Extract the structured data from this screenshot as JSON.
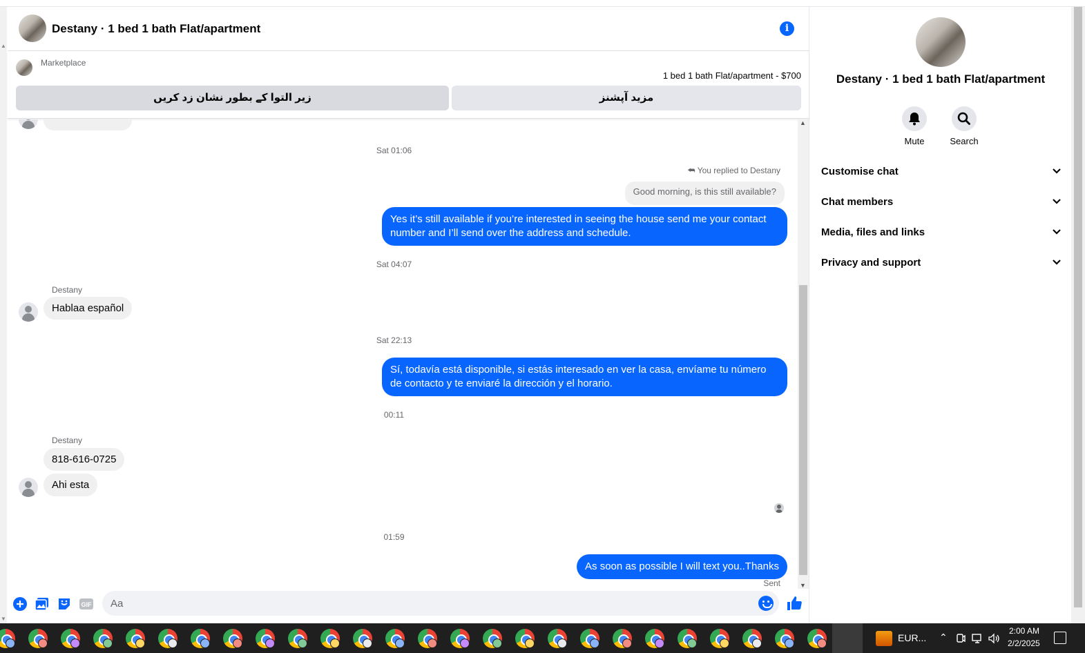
{
  "header": {
    "title": "Destany · 1 bed 1 bath Flat/apartment"
  },
  "marketplace": {
    "label": "Marketplace",
    "listing": "1 bed 1 bath Flat/apartment - $700",
    "mark_button": "زیر التوا کے بطور نشان زد کریں",
    "more_options_button": "مزید آپشنز"
  },
  "thread": {
    "ts1": "Sat 01:06",
    "reply_label": "You replied to Destany",
    "reply_quote": "Good morning, is this still available?",
    "out1": "Yes it’s still available if you’re interested in seeing the house send me your contact number and I’ll send over the address and schedule.",
    "ts2": "Sat 04:07",
    "sender1": "Destany",
    "in1": "Hablaa español",
    "ts3": "Sat 22:13",
    "out2": "Sí, todavía está disponible, si estás interesado en ver la casa, envíame tu número de contacto y te enviaré la dirección y el horario.",
    "ts4": "00:11",
    "sender2": "Destany",
    "in2": "818-616-0725",
    "in3": "Ahi esta",
    "ts5": "01:59",
    "out3": "As soon as possible I will text you..Thanks",
    "status": "Sent"
  },
  "composer": {
    "placeholder": "Aa",
    "gif_label": "GIF"
  },
  "sidebar": {
    "title": "Destany · 1 bed 1 bath Flat/apartment",
    "mute_label": "Mute",
    "search_label": "Search",
    "sections": [
      {
        "label": "Customise chat"
      },
      {
        "label": "Chat members"
      },
      {
        "label": "Media, files and links"
      },
      {
        "label": "Privacy and support"
      }
    ]
  },
  "taskbar": {
    "tray_label": "EUR...",
    "time": "2:00 AM",
    "date": "2/2/2025"
  },
  "colors": {
    "accent": "#0866ff",
    "bubble_in": "#f0f0f0",
    "taskbar": "#1f1f1f"
  }
}
